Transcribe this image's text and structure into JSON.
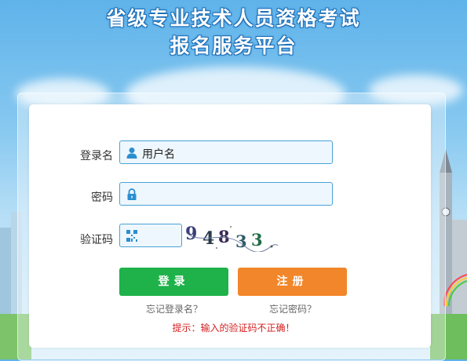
{
  "header": {
    "title_line1": "省级专业技术人员资格考试",
    "title_line2": "报名服务平台"
  },
  "form": {
    "username_label": "登录名",
    "username_value": "用户名",
    "password_label": "密码",
    "password_value": "",
    "captcha_label": "验证码",
    "captcha_value": "",
    "captcha_image_text": "94833"
  },
  "actions": {
    "login_label": "登录",
    "register_label": "注册",
    "forgot_username": "忘记登录名？",
    "forgot_password": "忘记密码？"
  },
  "message": {
    "hint": "提示：输入的验证码不正确！"
  },
  "colors": {
    "login_green": "#1fb24a",
    "register_orange": "#f2862a",
    "field_border": "#48a3d8",
    "hint_red": "#d42020"
  },
  "icons": {
    "username": "user-icon",
    "password": "lock-icon",
    "captcha": "qr-icon"
  }
}
